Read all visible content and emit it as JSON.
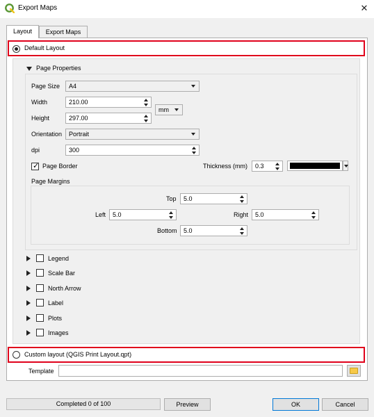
{
  "window": {
    "title": "Export Maps",
    "close_glyph": "✕"
  },
  "tabs": [
    {
      "label": "Layout",
      "active": true
    },
    {
      "label": "Export Maps",
      "active": false
    }
  ],
  "default_layout": {
    "label": "Default Layout",
    "checked": true
  },
  "page_properties": {
    "heading": "Page Properties",
    "page_size_label": "Page Size",
    "page_size_value": "A4",
    "width_label": "Width",
    "width_value": "210.00",
    "height_label": "Height",
    "height_value": "297.00",
    "unit_value": "mm",
    "orientation_label": "Orientation",
    "orientation_value": "Portrait",
    "dpi_label": "dpi",
    "dpi_value": "300",
    "page_border_label": "Page Border",
    "page_border_checked": true,
    "thickness_label": "Thickness (mm)",
    "thickness_value": "0.3",
    "border_color": "#000000"
  },
  "page_margins": {
    "heading": "Page Margins",
    "top_label": "Top",
    "top_value": "5.0",
    "left_label": "Left",
    "left_value": "5.0",
    "right_label": "Right",
    "right_value": "5.0",
    "bottom_label": "Bottom",
    "bottom_value": "5.0"
  },
  "sections": [
    {
      "label": "Legend",
      "checked": false
    },
    {
      "label": "Scale Bar",
      "checked": false
    },
    {
      "label": "North Arrow",
      "checked": false
    },
    {
      "label": "Label",
      "checked": false
    },
    {
      "label": "Plots",
      "checked": false
    },
    {
      "label": "Images",
      "checked": false
    }
  ],
  "custom_layout": {
    "label": "Custom layout (QGIS Print Layout.qpt)",
    "checked": false
  },
  "template": {
    "label": "Template",
    "value": ""
  },
  "footer": {
    "progress_text": "Completed 0 of 100",
    "preview_label": "Preview",
    "ok_label": "OK",
    "cancel_label": "Cancel"
  },
  "colors": {
    "highlight": "#e0001b",
    "app_icon": "#589632"
  }
}
